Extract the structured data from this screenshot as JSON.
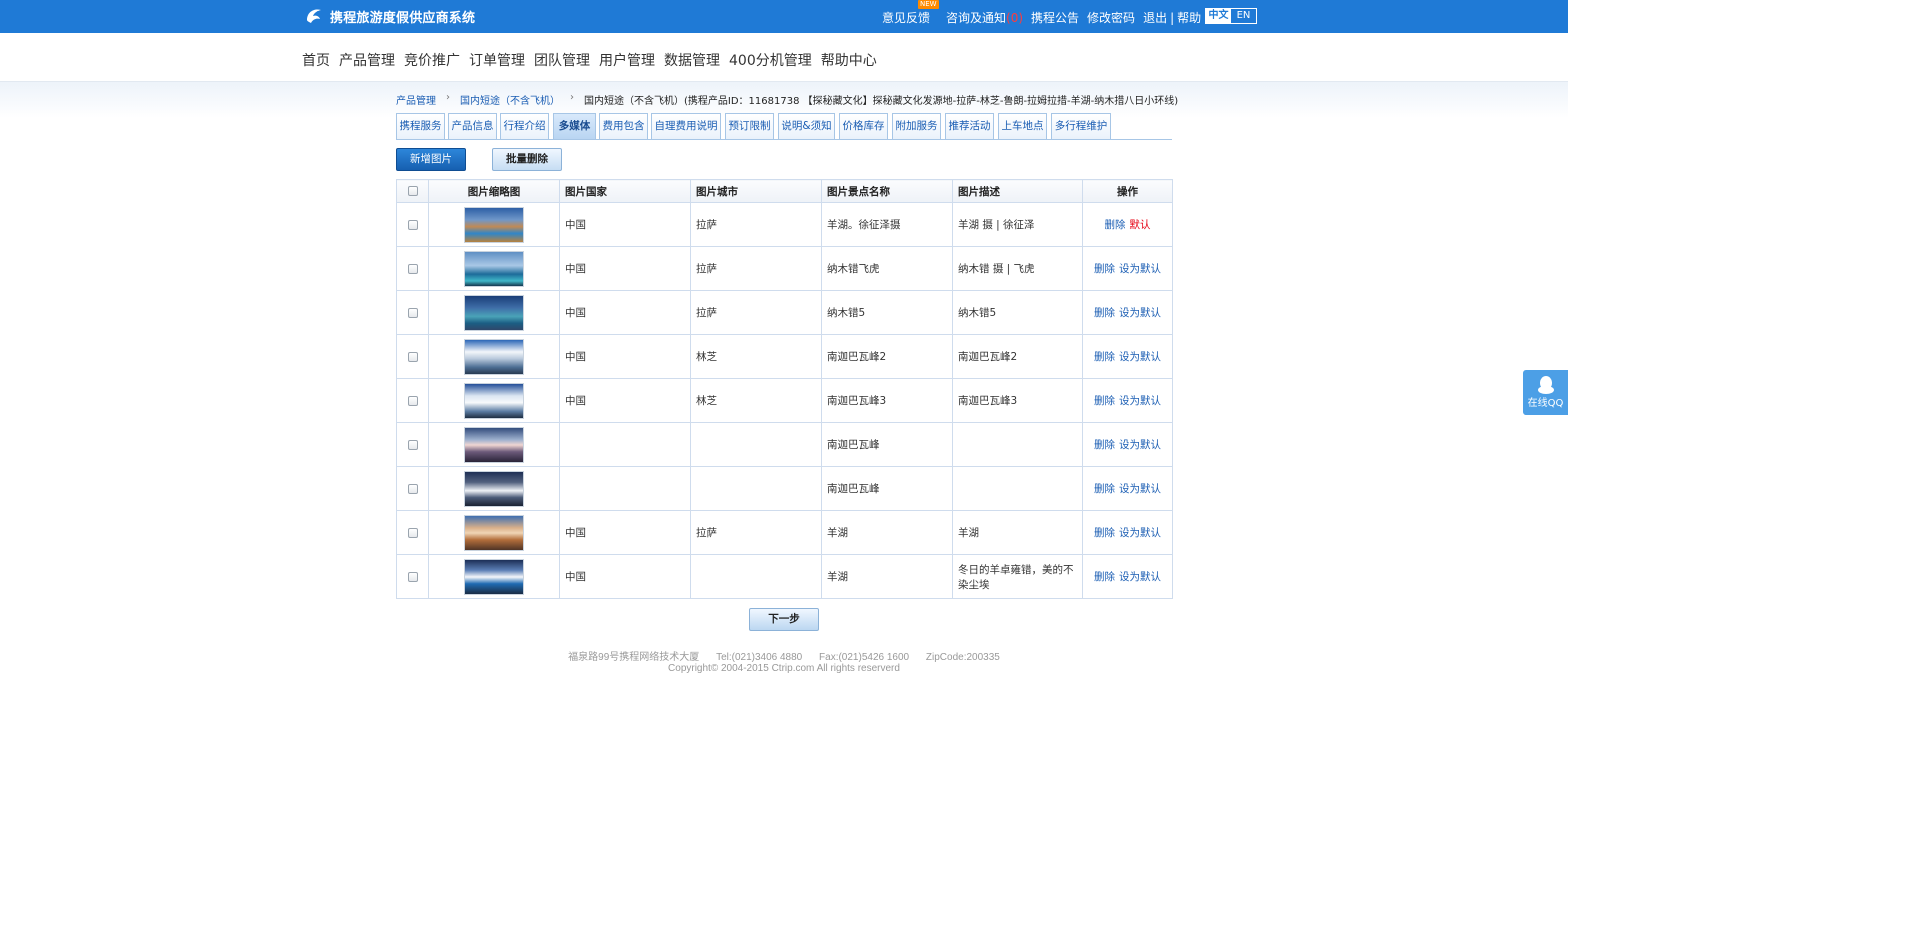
{
  "header": {
    "logo_text": "携程旅游度假供应商系统",
    "links": {
      "feedback": "意见反馈",
      "new_badge": "NEW",
      "notice": "咨询及通知",
      "notice_count": "(0)",
      "announcement": "携程公告",
      "password": "修改密码",
      "logout": "退出",
      "divider": "|",
      "help": "帮助"
    },
    "lang": {
      "zh": "中文",
      "en": "EN"
    }
  },
  "mainnav": [
    "首页",
    "产品管理",
    "竞价推广",
    "订单管理",
    "团队管理",
    "用户管理",
    "数据管理",
    "400分机管理",
    "帮助中心"
  ],
  "breadcrumb": {
    "level1": "产品管理",
    "level2": "国内短途（不含飞机）",
    "current": "国内短途（不含飞机）(携程产品ID：11681738 【探秘藏文化】探秘藏文化发源地-拉萨-林芝-鲁朗-拉姆拉措-羊湖-纳木措八日小环线)"
  },
  "tabs": [
    "携程服务",
    "产品信息",
    "行程介绍",
    "多媒体",
    "费用包含",
    "自理费用说明",
    "预订限制",
    "说明&须知",
    "价格库存",
    "附加服务",
    "推荐活动",
    "上车地点",
    "多行程维护"
  ],
  "toolbar": {
    "add": "新增图片",
    "batch_delete": "批量删除"
  },
  "table": {
    "headers": {
      "thumb": "图片缩略图",
      "country": "图片国家",
      "city": "图片城市",
      "spot": "图片景点名称",
      "desc": "图片描述",
      "action": "操作"
    },
    "rows": [
      {
        "country": "中国",
        "city": "拉萨",
        "spot": "羊湖。徐征泽摄",
        "desc": "羊湖 摄 | 徐征泽",
        "del": "删除",
        "default": "默认",
        "is_default": true
      },
      {
        "country": "中国",
        "city": "拉萨",
        "spot": "纳木错飞虎",
        "desc": "纳木错 摄 | 飞虎",
        "del": "删除",
        "default": "设为默认",
        "is_default": false
      },
      {
        "country": "中国",
        "city": "拉萨",
        "spot": "纳木错5",
        "desc": "纳木错5",
        "del": "删除",
        "default": "设为默认",
        "is_default": false
      },
      {
        "country": "中国",
        "city": "林芝",
        "spot": "南迦巴瓦峰2",
        "desc": "南迦巴瓦峰2",
        "del": "删除",
        "default": "设为默认",
        "is_default": false
      },
      {
        "country": "中国",
        "city": "林芝",
        "spot": "南迦巴瓦峰3",
        "desc": "南迦巴瓦峰3",
        "del": "删除",
        "default": "设为默认",
        "is_default": false
      },
      {
        "country": "",
        "city": "",
        "spot": "南迦巴瓦峰",
        "desc": "",
        "del": "删除",
        "default": "设为默认",
        "is_default": false
      },
      {
        "country": "",
        "city": "",
        "spot": "南迦巴瓦峰",
        "desc": "",
        "del": "删除",
        "default": "设为默认",
        "is_default": false
      },
      {
        "country": "中国",
        "city": "拉萨",
        "spot": "羊湖",
        "desc": "羊湖",
        "del": "删除",
        "default": "设为默认",
        "is_default": false
      },
      {
        "country": "中国",
        "city": "",
        "spot": "羊湖",
        "desc": "冬日的羊卓雍错，美的不染尘埃",
        "del": "删除",
        "default": "设为默认",
        "is_default": false
      }
    ]
  },
  "next_button": "下一步",
  "footer": {
    "address": "福泉路99号携程网络技术大厦",
    "tel": "Tel:(021)3406 4880",
    "fax": "Fax:(021)5426 1600",
    "zip": "ZipCode:200335",
    "copyright": "Copyright© 2004-2015 Ctrip.com All rights reserverd"
  },
  "qq_widget": "在线QQ"
}
